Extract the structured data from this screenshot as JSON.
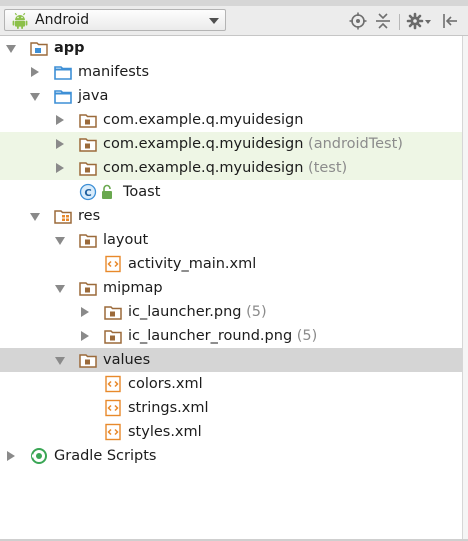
{
  "toolbar": {
    "view_label": "Android",
    "buttons": [
      "sync-icon",
      "collapse-all-icon",
      "gear-icon",
      "hide-icon"
    ]
  },
  "tree": [
    {
      "label": "app",
      "icon": "module-folder-icon",
      "bold": true
    },
    {
      "label": "manifests",
      "icon": "folder-icon"
    },
    {
      "label": "java",
      "icon": "folder-icon"
    },
    {
      "label": "com.example.q.myuidesign",
      "icon": "package-icon"
    },
    {
      "label": "com.example.q.myuidesign",
      "suffix": "(androidTest)",
      "icon": "package-icon"
    },
    {
      "label": "com.example.q.myuidesign",
      "suffix": "(test)",
      "icon": "package-icon"
    },
    {
      "label": "Toast",
      "icon": "class-icon"
    },
    {
      "label": "res",
      "icon": "res-folder-icon"
    },
    {
      "label": "layout",
      "icon": "folder-icon"
    },
    {
      "label": "activity_main.xml",
      "icon": "xml-file-icon"
    },
    {
      "label": "mipmap",
      "icon": "folder-icon"
    },
    {
      "label": "ic_launcher.png",
      "suffix": "(5)",
      "icon": "folder-icon"
    },
    {
      "label": "ic_launcher_round.png",
      "suffix": "(5)",
      "icon": "folder-icon"
    },
    {
      "label": "values",
      "icon": "folder-icon"
    },
    {
      "label": "colors.xml",
      "icon": "xml-file-icon"
    },
    {
      "label": "strings.xml",
      "icon": "xml-file-icon"
    },
    {
      "label": "styles.xml",
      "icon": "xml-file-icon"
    },
    {
      "label": "Gradle Scripts",
      "icon": "gradle-icon"
    }
  ],
  "colors": {
    "selected_row": "#d5d5d5",
    "test_row": "#eef6e5",
    "folder_blue": "#3d8fd6",
    "package_brown": "#9b6a3a",
    "xml_orange": "#e8892b",
    "android_green": "#8cc04a"
  }
}
